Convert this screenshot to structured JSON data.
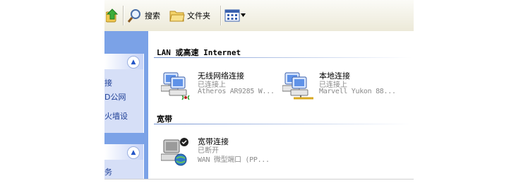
{
  "toolbar": {
    "search_label": "搜索",
    "folders_label": "文件夹"
  },
  "task_pane": {
    "links": [
      "接",
      "D公网",
      "火墙设",
      "务"
    ]
  },
  "groups": [
    {
      "title": "LAN 或高速 Internet",
      "items": [
        {
          "name": "无线网络连接",
          "status": "已连接上",
          "device": "Atheros AR9285 W..."
        },
        {
          "name": "本地连接",
          "status": "已连接上",
          "device": "Marvell Yukon 88..."
        }
      ]
    },
    {
      "title": "宽带",
      "items": [
        {
          "name": "宽带连接",
          "status": "已断开",
          "device": "WAN 微型端口 (PP..."
        }
      ]
    }
  ],
  "colors": {
    "pane_blue": "#7ba2e7",
    "link_blue": "#1e3f96",
    "status_gray": "#8a8a8a"
  }
}
